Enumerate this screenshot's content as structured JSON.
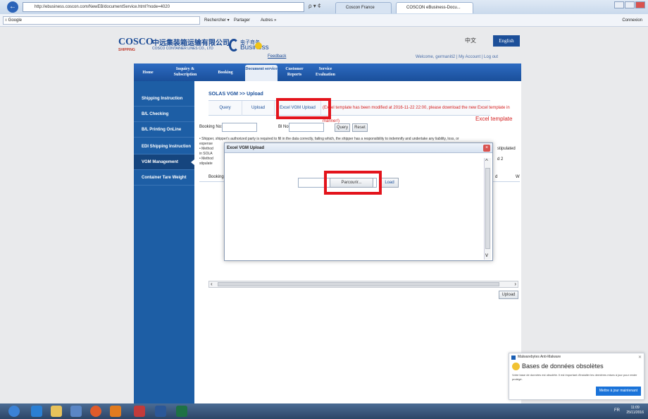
{
  "browser": {
    "url": "http://ebusiness.coscon.com/NewEB/documentService.html?node=4020",
    "address_icons": "ρ ▾ ¢",
    "tabs": [
      "Coscon France",
      "COSCON eBusiness-Docu..."
    ],
    "search_label": "Google",
    "toolbar": [
      "Rechercher ▾",
      "Partager",
      "Autres »"
    ],
    "connexion": "Connexion"
  },
  "header": {
    "logo": "COSCO",
    "logo_sub": "SHIPPING",
    "company_cn": "中远集装箱运输有限公司",
    "company_en": "COSCO CONTAINER LINES CO., LTD",
    "ebiz_cn": "电子商务",
    "ebiz_en": "Business",
    "feedback": "Feedback",
    "lang_cn": "中文",
    "lang_en": "English",
    "welcome": "Welcome, germaniti2 | My Account | Log out"
  },
  "nav": [
    "Home",
    "Inquiry & Subscription",
    "Booking",
    "Document service",
    "Customer Reports",
    "Service Evaluation"
  ],
  "sidebar": [
    "Shipping Instruction",
    "B/L Checking",
    "B/L Printing OnLine",
    "EDI Shipping Instruction",
    "VGM Management",
    "Container Tare Weight"
  ],
  "page": {
    "breadcrumb": "SOLAS VGM >> Upload",
    "subtabs": [
      "Query",
      "Upload",
      "Excel VGM Upload"
    ],
    "notice": "(Excel template has been modified at 2016-11-22 22:00, please download the new Excel template in",
    "notice2": "manner!)",
    "excel_template": "Excel template",
    "booking_label": "Booking No:",
    "bl_label": "Bl No:",
    "query_btn": "Query",
    "reset_btn": "Reset",
    "bullet1": "• Shipper, shipper's authorized party is required to fill in the data correctly, failing which, the shipper has a responsibility to indemnify and undertake any liability, loss, or",
    "bullet1b": "expense",
    "bullet2": "• Method",
    "bullet2b": "in SOLA",
    "bullet3": "• Method",
    "bullet3b": "stipulate",
    "right1": "stipulated",
    "right2": "d 2",
    "table_head": "Booking",
    "table_head_r": "d",
    "table_head_r2": "W",
    "upload_btn": "Upload"
  },
  "modal": {
    "title": "Excel VGM Upload",
    "browse_btn": "Parcourir...",
    "load_btn": "Load"
  },
  "notification": {
    "app": "Malwarebytes Anti-Malware",
    "heading": "Bases de données obsolètes",
    "body": "Votre base de données est obsolète. Il est important d'installer les dernières mises à jour pour rester protégé.",
    "button": "Mettre à jour maintenant"
  },
  "taskbar": {
    "lang": "FR",
    "time": "11:09",
    "date": "25/11/2016"
  }
}
